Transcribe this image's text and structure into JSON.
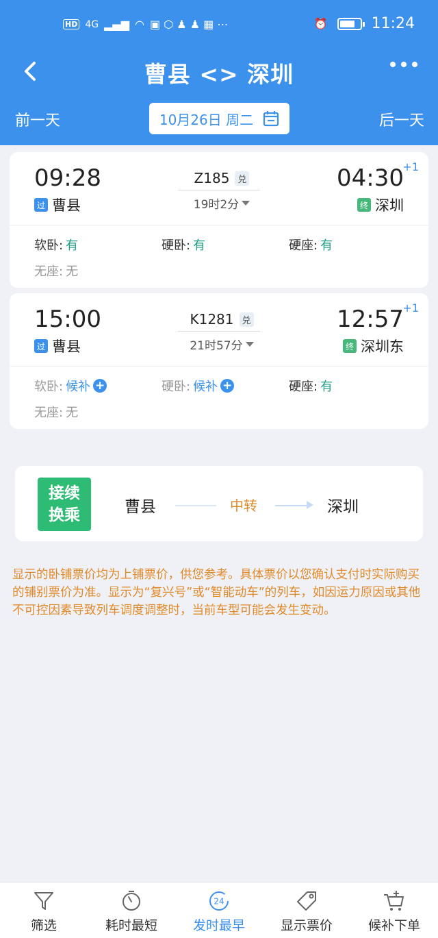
{
  "status_bar": {
    "left_text": "HD",
    "network": "4G",
    "time": "11:24",
    "battery_level": 0.75
  },
  "header": {
    "title": "曹县 <> 深圳",
    "prev_day": "前一天",
    "next_day": "后一天",
    "date": "10月26日 周二"
  },
  "trains": [
    {
      "dep_time": "09:28",
      "arr_time": "04:30",
      "day_offset": "+1",
      "dep_tag": "过",
      "dep_station": "曹县",
      "arr_tag": "终",
      "arr_station": "深圳",
      "train_no": "Z185",
      "dui": "兑",
      "duration": "19时2分",
      "seats": [
        {
          "label": "软卧:",
          "value": "有"
        },
        {
          "label": "硬卧:",
          "value": "有"
        },
        {
          "label": "硬座:",
          "value": "有"
        },
        {
          "label": "无座:",
          "value": "无"
        }
      ]
    },
    {
      "dep_time": "15:00",
      "arr_time": "12:57",
      "day_offset": "+1",
      "dep_tag": "过",
      "dep_station": "曹县",
      "arr_tag": "终",
      "arr_station": "深圳东",
      "train_no": "K1281",
      "dui": "兑",
      "duration": "21时57分",
      "seats": [
        {
          "label": "软卧:",
          "value": "候补"
        },
        {
          "label": "硬卧:",
          "value": "候补"
        },
        {
          "label": "硬座:",
          "value": "有"
        },
        {
          "label": "无座:",
          "value": "无"
        }
      ]
    }
  ],
  "transfer": {
    "badge_line1": "接续",
    "badge_line2": "换乘",
    "from": "曹县",
    "middle": "中转",
    "to": "深圳"
  },
  "notice": "显示的卧铺票价均为上铺票价，供您参考。具体票价以您确认支付时实际购买的铺别票价为准。显示为“复兴号”或“智能动车”的列车，如因运力原因或其他不可控因素导致列车调度调整时，当前车型可能会发生变动。",
  "tabs": [
    {
      "label": "筛选",
      "icon": "filter-icon",
      "active": false
    },
    {
      "label": "耗时最短",
      "icon": "timer-icon",
      "active": false
    },
    {
      "label": "发时最早",
      "icon": "clock-24-icon",
      "active": true,
      "icon_text": "24"
    },
    {
      "label": "显示票价",
      "icon": "price-tag-icon",
      "active": false
    },
    {
      "label": "候补下单",
      "icon": "cart-plus-icon",
      "active": false
    }
  ],
  "colors": {
    "brand_blue": "#3b91ec",
    "green": "#2ebc74",
    "orange": "#e08a2a",
    "available_green": "#1e9e86"
  }
}
